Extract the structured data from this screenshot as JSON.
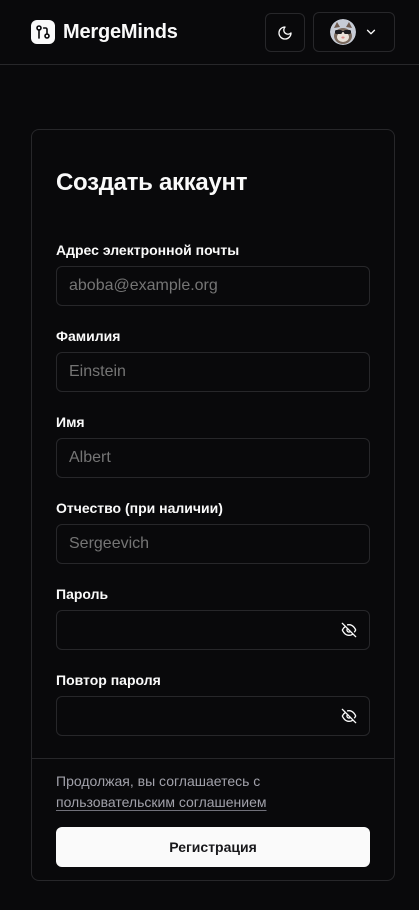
{
  "colors": {
    "background": "#09090b",
    "border": "#27272a",
    "foreground": "#fafafa",
    "muted": "#a1a1aa",
    "primary_button": "#fafafa"
  },
  "header": {
    "brand_name": "MergeMinds",
    "logo_icon": "git-pull-request-icon",
    "theme_toggle_icon": "moon-icon",
    "user_menu_icon": "chevron-down-icon"
  },
  "form": {
    "title": "Создать аккаунт",
    "fields": [
      {
        "label": "Адрес электронной почты",
        "value": "",
        "placeholder": "aboba@example.org",
        "type": "email"
      },
      {
        "label": "Фамилия",
        "value": "",
        "placeholder": "Einstein",
        "type": "text"
      },
      {
        "label": "Имя",
        "value": "",
        "placeholder": "Albert",
        "type": "text"
      },
      {
        "label": "Отчество (при наличии)",
        "value": "",
        "placeholder": "Sergeevich",
        "type": "text"
      },
      {
        "label": "Пароль",
        "value": "",
        "placeholder": "",
        "type": "password",
        "toggle_icon": "eye-off-icon"
      },
      {
        "label": "Повтор пароля",
        "value": "",
        "placeholder": "",
        "type": "password",
        "toggle_icon": "eye-off-icon"
      }
    ],
    "terms_text": "Продолжая, вы соглашаетесь с",
    "terms_link": "пользовательским соглашением",
    "submit_label": "Регистрация"
  }
}
